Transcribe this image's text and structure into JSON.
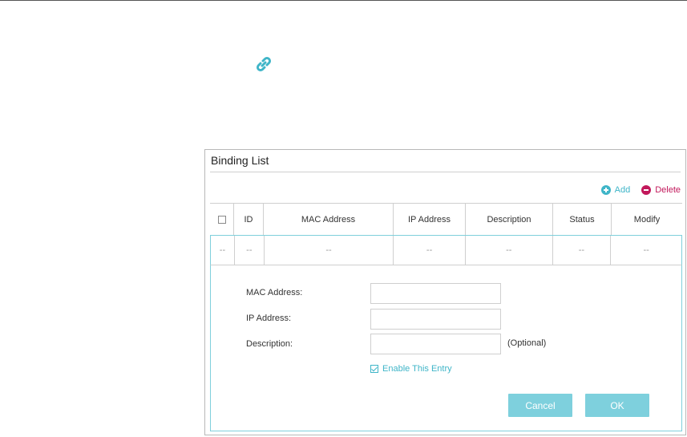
{
  "panel": {
    "title": "Binding List",
    "toolbar": {
      "add_label": "Add",
      "delete_label": "Delete"
    }
  },
  "table": {
    "headers": [
      "ID",
      "MAC Address",
      "IP Address",
      "Description",
      "Status",
      "Modify"
    ],
    "rows": [
      [
        "--",
        "--",
        "--",
        "--",
        "--",
        "--",
        "--"
      ]
    ]
  },
  "form": {
    "mac_label": "MAC Address:",
    "ip_label": "IP Address:",
    "desc_label": "Description:",
    "mac_value": "",
    "ip_value": "",
    "desc_value": "",
    "optional_note": "(Optional)",
    "enable_label": "Enable This Entry",
    "enable_checked": true,
    "cancel_label": "Cancel",
    "ok_label": "OK"
  },
  "colors": {
    "accent": "#3fb5c8",
    "delete": "#c2185b",
    "button": "#7ed0dd"
  },
  "icons": {
    "top": "link-icon",
    "add": "plus-circle-icon",
    "delete": "minus-circle-icon"
  }
}
